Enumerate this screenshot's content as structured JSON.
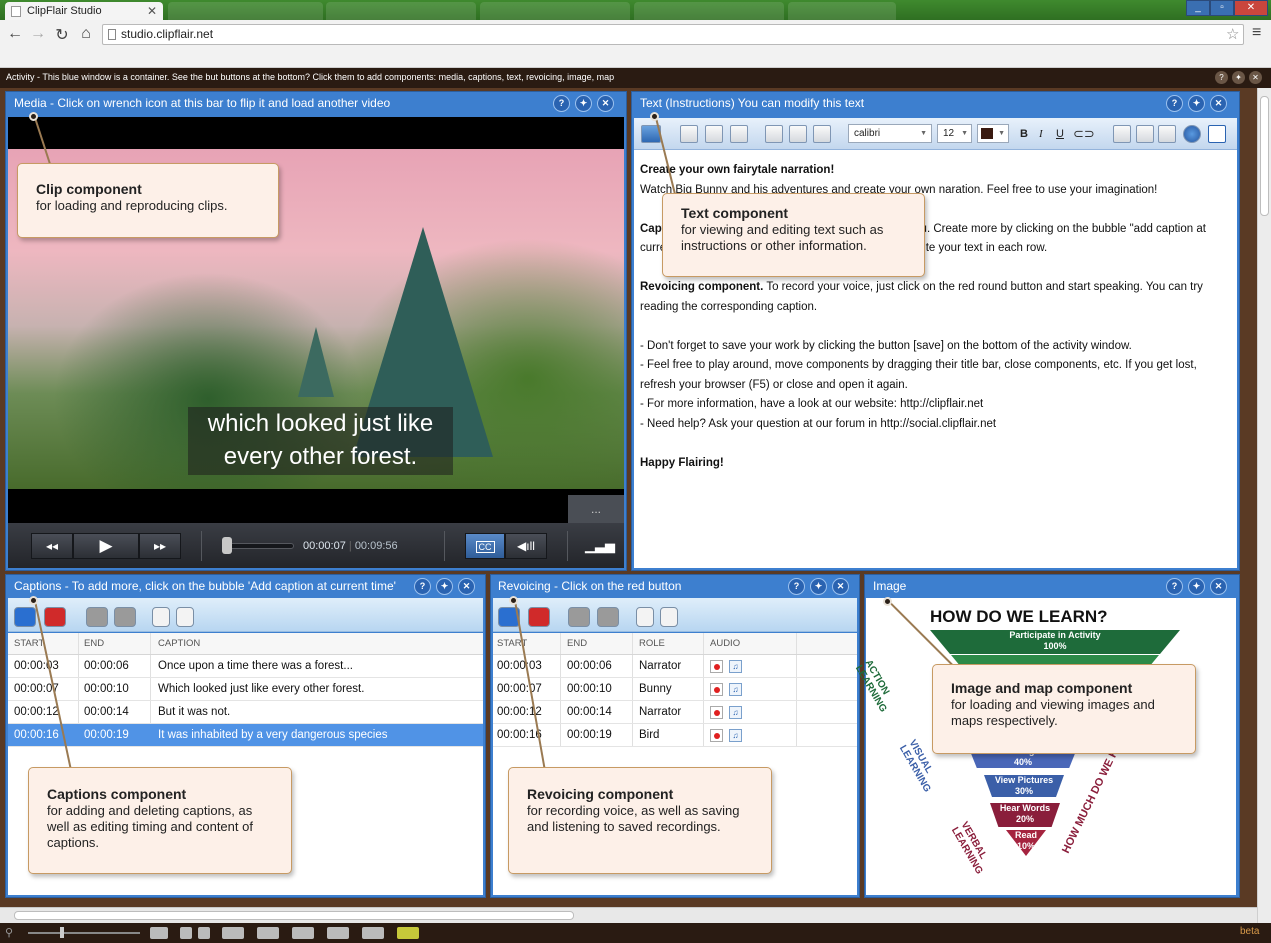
{
  "browser": {
    "tab_title": "ClipFlair Studio",
    "url": "studio.clipflair.net"
  },
  "app": {
    "activity_text": "Activity - This blue window is a container. See the but buttons at the bottom? Click them to add components: media, captions, text, revoicing, image, map",
    "beta_label": "beta"
  },
  "panel_buttons": {
    "help": "?",
    "settings": "🔧",
    "close": "✕"
  },
  "media": {
    "title": "Media - Click on wrench icon at this bar to flip it and load another video",
    "subtitle_line1": "which looked just like",
    "subtitle_line2": "every other forest.",
    "current_time": "00:00:07",
    "separator": "|",
    "total_time": "00:09:56",
    "more_label": "...",
    "cc_label": "CC"
  },
  "text_component": {
    "title": "Text (Instructions) You can modify this text",
    "font": "calibri",
    "size": "12",
    "bold": "B",
    "italic": "I",
    "underline": "U",
    "paragraphs": [
      {
        "bold": "Create your own fairytale narration!",
        "rest": ""
      },
      {
        "bold": "",
        "rest": "Watch Big Bunny and his adventures and create your own naration. Feel free to use your imagination!"
      },
      {
        "bold": "Captions component.",
        "rest": " Some captions are ready for you. Create more by clicking on the bubble \"add caption at current time\" (blue bubble). New rows will be added. Write your text in each row."
      },
      {
        "bold": "Revoicing component.",
        "rest": " To record your voice, just click on the red round button and start speaking. You can try reading the corresponding caption."
      },
      {
        "bold": "",
        "rest": "- Don't forget to save your work by clicking the button [save] on the bottom of the activity window.\n- Feel free to play around, move components by dragging their title bar, close components, etc. If you get lost, refresh your browser (F5) or close and open it again.\n- For more information, have a look at our website: http://clipflair.net\n- Need help? Ask your question at our forum in http://social.clipflair.net"
      },
      {
        "bold": "Happy Flairing!",
        "rest": ""
      }
    ]
  },
  "captions": {
    "title": "Captions - To add more, click on the bubble 'Add caption at current time'",
    "columns": [
      "START",
      "END",
      "CAPTION"
    ],
    "rows": [
      {
        "start": "00:00:03",
        "end": "00:00:06",
        "caption": "Once upon a time there was a forest..."
      },
      {
        "start": "00:00:07",
        "end": "00:00:10",
        "caption": "Which looked just like every other forest."
      },
      {
        "start": "00:00:12",
        "end": "00:00:14",
        "caption": "But it was not."
      },
      {
        "start": "00:00:16",
        "end": "00:00:19",
        "caption": "It was inhabited by a very dangerous species"
      }
    ]
  },
  "revoicing": {
    "title": "Revoicing - Click on the red button",
    "columns": [
      "START",
      "END",
      "ROLE",
      "AUDIO"
    ],
    "rows": [
      {
        "start": "00:00:03",
        "end": "00:00:06",
        "role": "Narrator"
      },
      {
        "start": "00:00:07",
        "end": "00:00:10",
        "role": "Bunny"
      },
      {
        "start": "00:00:12",
        "end": "00:00:14",
        "role": "Narrator"
      },
      {
        "start": "00:00:16",
        "end": "00:00:19",
        "role": "Bird"
      }
    ]
  },
  "image": {
    "title": "Image",
    "heading": "HOW DO WE LEARN?",
    "bands": [
      {
        "label": "Participate in Activity",
        "pct": "100%"
      },
      {
        "label": "Watch Moving Pictures",
        "pct": "40%"
      },
      {
        "label": "View Pictures",
        "pct": "30%"
      },
      {
        "label": "Hear Words",
        "pct": "20%"
      },
      {
        "label": "Read",
        "pct": "10%"
      }
    ],
    "side_action": "ACTION LEARNING",
    "side_visual": "VISUAL LEARNING",
    "side_verbal": "VERBAL LEARNING",
    "side_right": "HOW MUCH DO WE REMEMBER?"
  },
  "callouts": {
    "clip": {
      "title": "Clip component",
      "desc": "for loading and reproducing clips."
    },
    "text": {
      "title": "Text component",
      "desc": "for viewing and editing text such as instructions or other information."
    },
    "captions": {
      "title": "Captions component",
      "desc": "for adding and deleting captions, as well as editing timing and content of captions."
    },
    "revoicing": {
      "title": "Revoicing component",
      "desc": "for recording voice, as well as saving and listening to saved recordings."
    },
    "image": {
      "title": "Image and map component",
      "desc": "for loading and viewing images and maps respectively."
    }
  },
  "colors": {
    "panel_blue": "#3d7fcf",
    "app_brown": "#2a1b12",
    "selection": "#5093e6",
    "callout_bg": "#fdf0e8"
  }
}
